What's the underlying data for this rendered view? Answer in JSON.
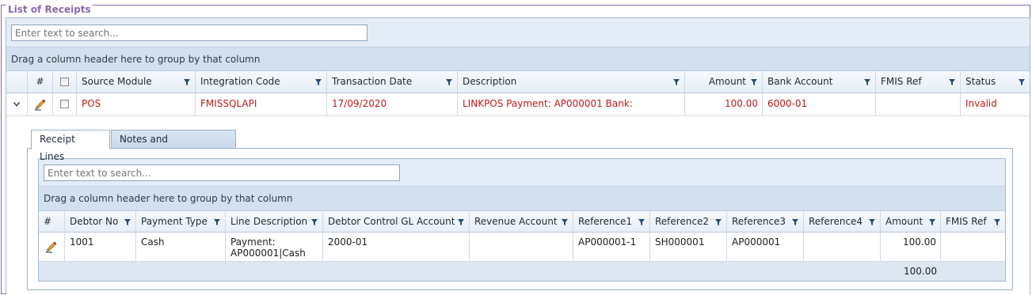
{
  "panel": {
    "title": "List of Receipts"
  },
  "main_grid": {
    "search_placeholder": "Enter text to search...",
    "group_hint": "Drag a column header here to group by that column",
    "columns": {
      "num": "#",
      "source_module": "Source Module",
      "integration_code": "Integration Code",
      "transaction_date": "Transaction Date",
      "description": "Description",
      "amount": "Amount",
      "bank_account": "Bank Account",
      "fmis_ref": "FMIS Ref",
      "status": "Status"
    },
    "rows": [
      {
        "source_module": "POS",
        "integration_code": "FMISSQLAPI",
        "transaction_date": "17/09/2020",
        "description": "LINKPOS Payment: AP000001 Bank:",
        "amount": "100.00",
        "bank_account": "6000-01",
        "fmis_ref": "",
        "status": "Invalid"
      }
    ]
  },
  "detail": {
    "tabs": [
      {
        "label": "Receipt Lines",
        "active": true
      },
      {
        "label": "Notes and Attachments",
        "active": false
      }
    ],
    "grid": {
      "search_placeholder": "Enter text to search...",
      "group_hint": "Drag a column header here to group by that column",
      "columns": {
        "num": "#",
        "debtor_no": "Debtor No",
        "payment_type": "Payment Type",
        "line_description": "Line Description",
        "debtor_control": "Debtor Control GL Account",
        "revenue_account": "Revenue Account",
        "reference1": "Reference1",
        "reference2": "Reference2",
        "reference3": "Reference3",
        "reference4": "Reference4",
        "amount": "Amount",
        "fmis_ref": "FMIS Ref"
      },
      "rows": [
        {
          "debtor_no": "1001",
          "payment_type": "Cash",
          "line_description_1": "Payment:",
          "line_description_2": "AP000001|Cash",
          "debtor_control": "2000-01",
          "revenue_account": "",
          "reference1": "AP000001-1",
          "reference2": "SH000001",
          "reference3": "AP000001",
          "reference4": "",
          "amount": "100.00",
          "fmis_ref": ""
        }
      ],
      "footer_total": "100.00"
    }
  },
  "icons": {
    "filter": "funnel-icon",
    "edit": "pencil-icon",
    "expand": "chevron-down-icon",
    "select_all": "checkbox-icon"
  },
  "colors": {
    "frame_border": "#8b68a8",
    "invalid_text": "#c21a1a",
    "group_bar": "#d3e0ef"
  }
}
